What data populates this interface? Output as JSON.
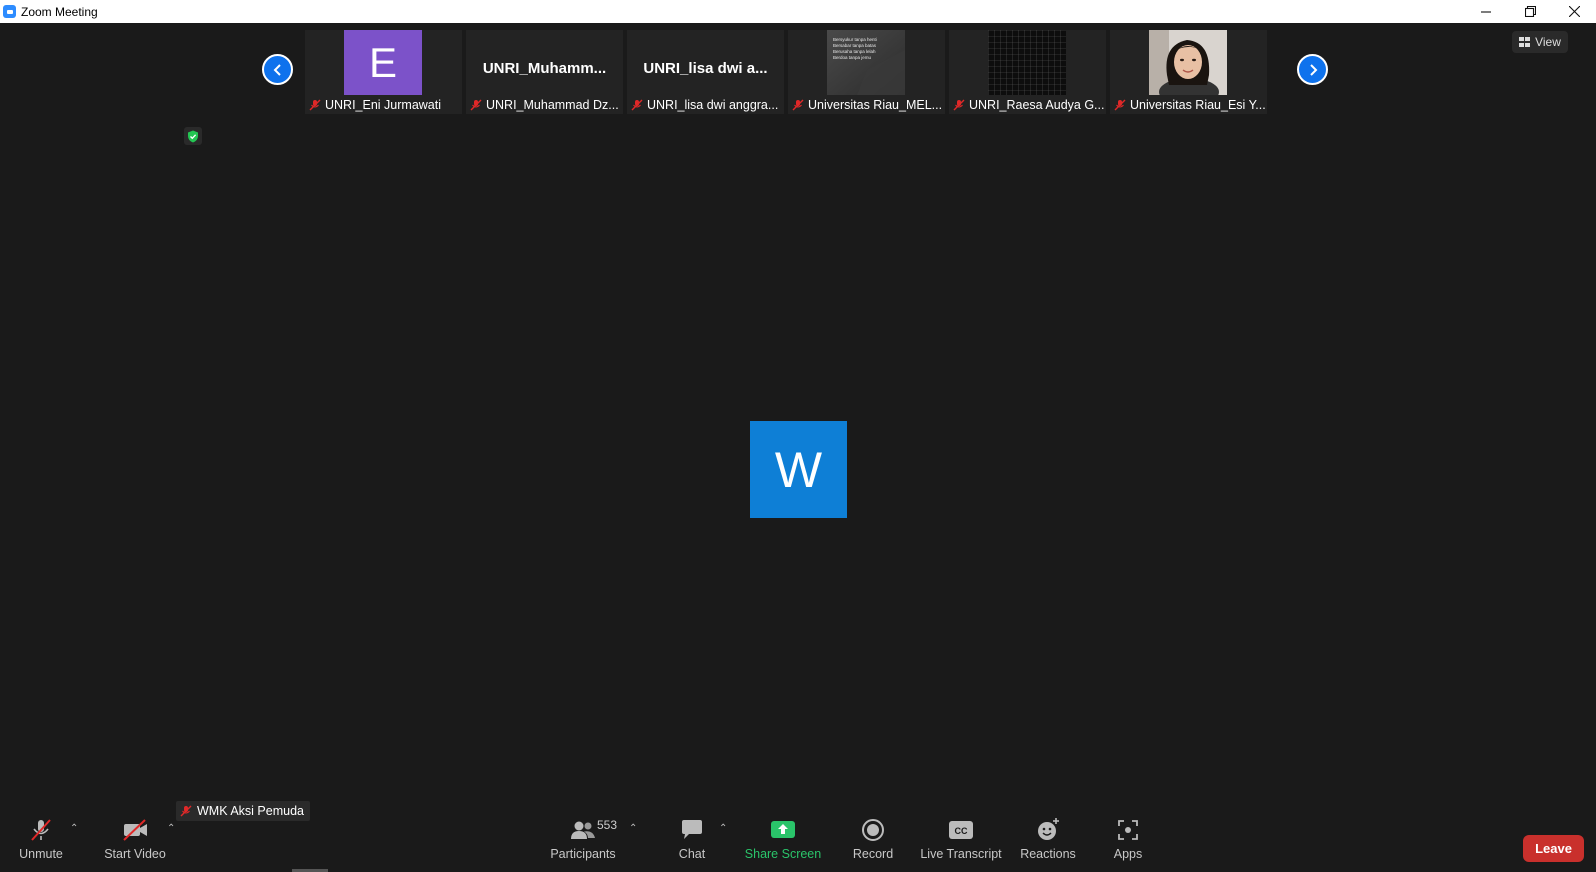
{
  "window": {
    "title": "Zoom Meeting"
  },
  "view_button": {
    "label": "View"
  },
  "gallery": {
    "tiles": [
      {
        "type": "avatar",
        "initial": "E",
        "avatar_color": "#7c52c9",
        "name": "UNRI_Eni Jurmawati"
      },
      {
        "type": "name",
        "display": "UNRI_Muhamm...",
        "name": "UNRI_Muhammad Dz..."
      },
      {
        "type": "name",
        "display": "UNRI_lisa dwi a...",
        "name": "UNRI_lisa dwi anggra..."
      },
      {
        "type": "photo",
        "photo_lines": [
          "Bersyukur tanpa henti",
          "Bersabar tanpa batas",
          "Berusaha tanpa lelah",
          "Berdoa tanpa jemu"
        ],
        "name": "Universitas Riau_MEL..."
      },
      {
        "type": "grid",
        "name": "UNRI_Raesa Audya G..."
      },
      {
        "type": "portrait",
        "name": "Universitas Riau_Esi Y..."
      }
    ]
  },
  "main_video": {
    "initial": "W",
    "color": "#0e7fd6"
  },
  "active_speaker": {
    "name": "WMK Aksi Pemuda"
  },
  "toolbar": {
    "unmute": "Unmute",
    "start_video": "Start Video",
    "participants": "Participants",
    "participant_count": "553",
    "chat": "Chat",
    "share_screen": "Share Screen",
    "record": "Record",
    "live_transcript": "Live Transcript",
    "reactions": "Reactions",
    "apps": "Apps",
    "leave": "Leave"
  },
  "colors": {
    "accent_blue": "#0e72ed",
    "share_green": "#2ac46a",
    "leave_red": "#c9302c",
    "background": "#1a1a1a"
  }
}
